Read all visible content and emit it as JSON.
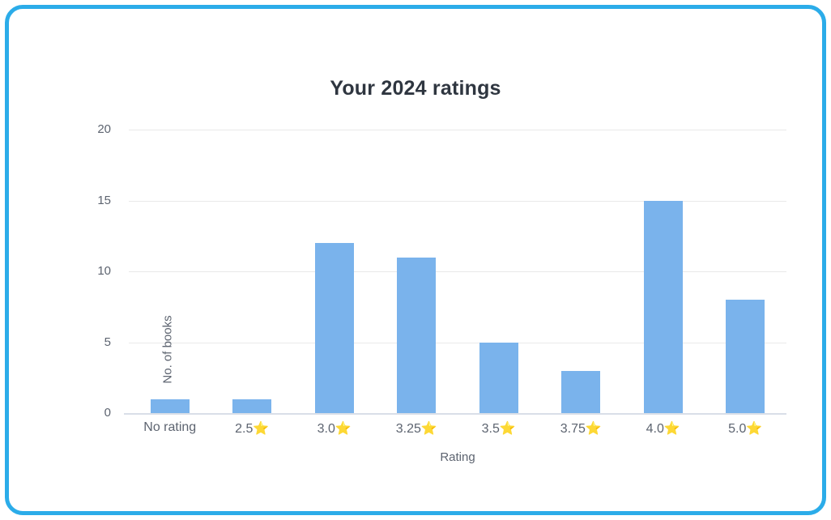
{
  "frame": {
    "border_color": "#2bace9",
    "background_color": "#ffffff"
  },
  "chart_data": {
    "type": "bar",
    "title": "Your 2024 ratings",
    "xlabel": "Rating",
    "ylabel": "No. of books",
    "categories": [
      "No rating",
      "2.5",
      "3.0",
      "3.25",
      "3.5",
      "3.75",
      "4.0",
      "5.0"
    ],
    "category_labels": [
      "No rating",
      "2.5⭐",
      "3.0⭐",
      "3.25⭐",
      "3.5⭐",
      "3.75⭐",
      "4.0⭐",
      "5.0⭐"
    ],
    "category_has_star": [
      false,
      true,
      true,
      true,
      true,
      true,
      true,
      true
    ],
    "values": [
      1,
      1,
      12,
      11,
      5,
      3,
      15,
      8
    ],
    "ylim": [
      0,
      20
    ],
    "yticks": [
      0,
      5,
      10,
      15,
      20
    ],
    "ytick_labels": [
      "0",
      "5",
      "10",
      "15",
      "20"
    ],
    "grid": true,
    "legend": false,
    "bar_color": "#7ab3ec",
    "gridline_color": "#e9e9e9",
    "axis_color": "#d9dfe8",
    "star_glyph": "⭐"
  }
}
